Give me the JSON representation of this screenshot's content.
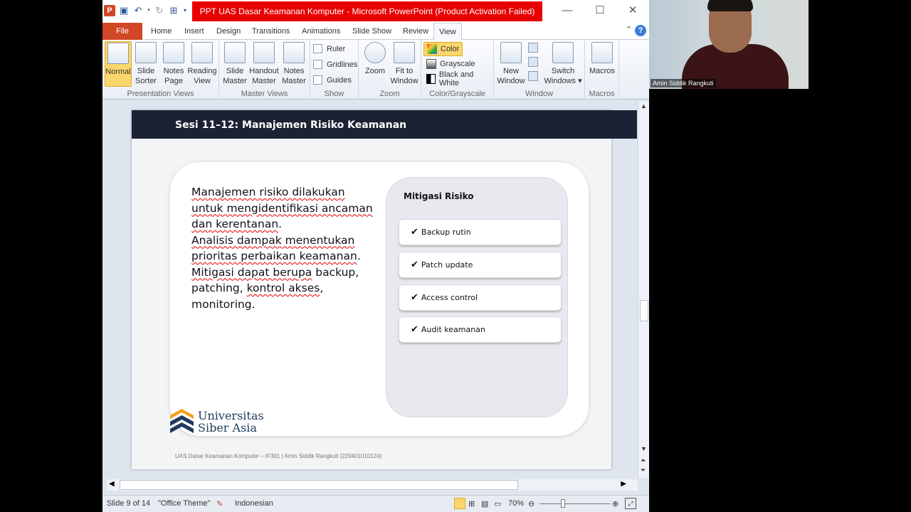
{
  "window": {
    "title": "PPT UAS Dasar Keamanan Komputer - Microsoft PowerPoint (Product Activation Failed)",
    "controls": {
      "minimize": "—",
      "maximize": "☐",
      "close": "✕"
    }
  },
  "tabs": [
    "File",
    "Home",
    "Insert",
    "Design",
    "Transitions",
    "Animations",
    "Slide Show",
    "Review",
    "View"
  ],
  "ribbon": {
    "presentation_views": {
      "label": "Presentation Views",
      "normal": "Normal",
      "slide_sorter": [
        "Slide",
        "Sorter"
      ],
      "notes_page": [
        "Notes",
        "Page"
      ],
      "reading_view": [
        "Reading",
        "View"
      ]
    },
    "master_views": {
      "label": "Master Views",
      "slide_master": [
        "Slide",
        "Master"
      ],
      "handout_master": [
        "Handout",
        "Master"
      ],
      "notes_master": [
        "Notes",
        "Master"
      ]
    },
    "show": {
      "label": "Show",
      "ruler": "Ruler",
      "gridlines": "Gridlines",
      "guides": "Guides"
    },
    "zoom": {
      "label": "Zoom",
      "zoom": "Zoom",
      "fit_to_window": [
        "Fit to",
        "Window"
      ]
    },
    "color": {
      "label": "Color/Grayscale",
      "color": "Color",
      "grayscale": "Grayscale",
      "black_white": "Black and White"
    },
    "window": {
      "label": "Window",
      "new_window": [
        "New",
        "Window"
      ],
      "switch_windows": [
        "Switch",
        "Windows ▾"
      ]
    },
    "macros": {
      "label": "Macros",
      "macros": "Macros"
    }
  },
  "slide": {
    "title": "Sesi 11–12: Manajemen Risiko Keamanan",
    "paragraph": [
      [
        {
          "t": "Manajemen risiko dilakukan",
          "sq": true
        }
      ],
      [
        {
          "t": "untuk mengidentifikasi ancaman",
          "sq": true
        }
      ],
      [
        {
          "t": "dan kerentanan",
          "sq": true
        },
        {
          "t": ".",
          "sq": false
        }
      ],
      [
        {
          "t": "Analisis dampak menentukan",
          "sq": true
        }
      ],
      [
        {
          "t": "prioritas perbaikan keamanan",
          "sq": true
        },
        {
          "t": ".",
          "sq": false
        }
      ],
      [
        {
          "t": "Mitigasi dapat berupa",
          "sq": true
        },
        {
          "t": " backup,",
          "sq": false
        }
      ],
      [
        {
          "t": "patching, ",
          "sq": false
        },
        {
          "t": "kontrol akses",
          "sq": true
        },
        {
          "t": ",",
          "sq": false
        }
      ],
      [
        {
          "t": "monitoring.",
          "sq": false
        }
      ]
    ],
    "mitigation_title": "Mitigasi Risiko",
    "mitigation_items": [
      "Backup rutin",
      "Patch update",
      "Access control",
      "Audit keamanan"
    ],
    "check_glyph": "✔",
    "logo": [
      "Universitas",
      "Siber Asia"
    ],
    "footer": "UAS Dasar Keamanan Komputer – IF301 | Amin Siddik Rangkuti (220401010124)"
  },
  "status": {
    "slide": "Slide 9 of 14",
    "theme": "\"Office Theme\"",
    "language": "Indonesian",
    "zoom": "70%"
  },
  "webcam": {
    "name": "Amin Siddik Rangkuti"
  },
  "colors": {
    "accent": "#d24726",
    "title_bar": "#e80000",
    "slide_header": "#1b2233",
    "selected": "#fbd66d"
  }
}
